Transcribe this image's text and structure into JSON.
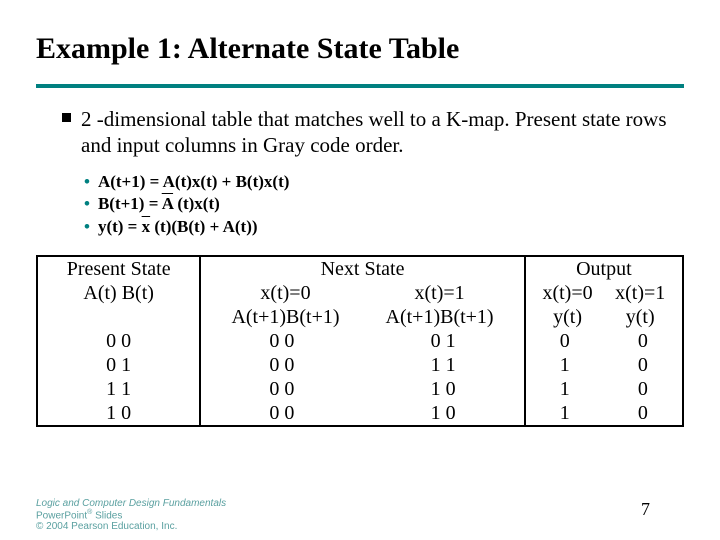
{
  "title": "Example 1: Alternate State Table",
  "lead": "2 -dimensional table that matches well to a K-map. Present state rows and input columns in Gray code order.",
  "equations": {
    "eq1_pre": "A(t+1) = A(t)x(t) + B(t)x(t)",
    "eq2_pre": "B(t+1) =  ",
    "eq2_obar": "A",
    "eq2_post": " (t)x(t)",
    "eq3_pre": "y(t) =  ",
    "eq3_obar": "x",
    "eq3_post": " (t)(B(t) + A(t))"
  },
  "table": {
    "col_headers": {
      "present": "Present State",
      "next": "Next State",
      "output": "Output",
      "x0": "x(t)=0",
      "x1": "x(t)=1",
      "ps_sub": "A(t) B(t)",
      "ns_sub": "A(t+1)B(t+1)",
      "out_sub": "y(t)"
    },
    "rows": [
      {
        "ps": "0  0",
        "ns0": "0  0",
        "ns1": "0  1",
        "y0": "0",
        "y1": "0"
      },
      {
        "ps": "0  1",
        "ns0": "0  0",
        "ns1": "1  1",
        "y0": "1",
        "y1": "0"
      },
      {
        "ps": "1  1",
        "ns0": "0  0",
        "ns1": "1  0",
        "y0": "1",
        "y1": "0"
      },
      {
        "ps": "1  0",
        "ns0": "0  0",
        "ns1": "1  0",
        "y0": "1",
        "y1": "0"
      }
    ]
  },
  "footer": {
    "l1": "Logic and Computer Design Fundamentals",
    "l2a": "PowerPoint",
    "l2sup": "®",
    "l2b": " Slides",
    "l3": "© 2004 Pearson Education, Inc."
  },
  "page": "7",
  "chart_data": {
    "type": "table",
    "title": "Alternate State Table",
    "columns": [
      "A(t)",
      "B(t)",
      "A(t+1) x=0",
      "B(t+1) x=0",
      "A(t+1) x=1",
      "B(t+1) x=1",
      "y(t) x=0",
      "y(t) x=1"
    ],
    "rows": [
      [
        0,
        0,
        0,
        0,
        0,
        1,
        0,
        0
      ],
      [
        0,
        1,
        0,
        0,
        1,
        1,
        1,
        0
      ],
      [
        1,
        1,
        0,
        0,
        1,
        0,
        1,
        0
      ],
      [
        1,
        0,
        0,
        0,
        1,
        0,
        1,
        0
      ]
    ]
  }
}
